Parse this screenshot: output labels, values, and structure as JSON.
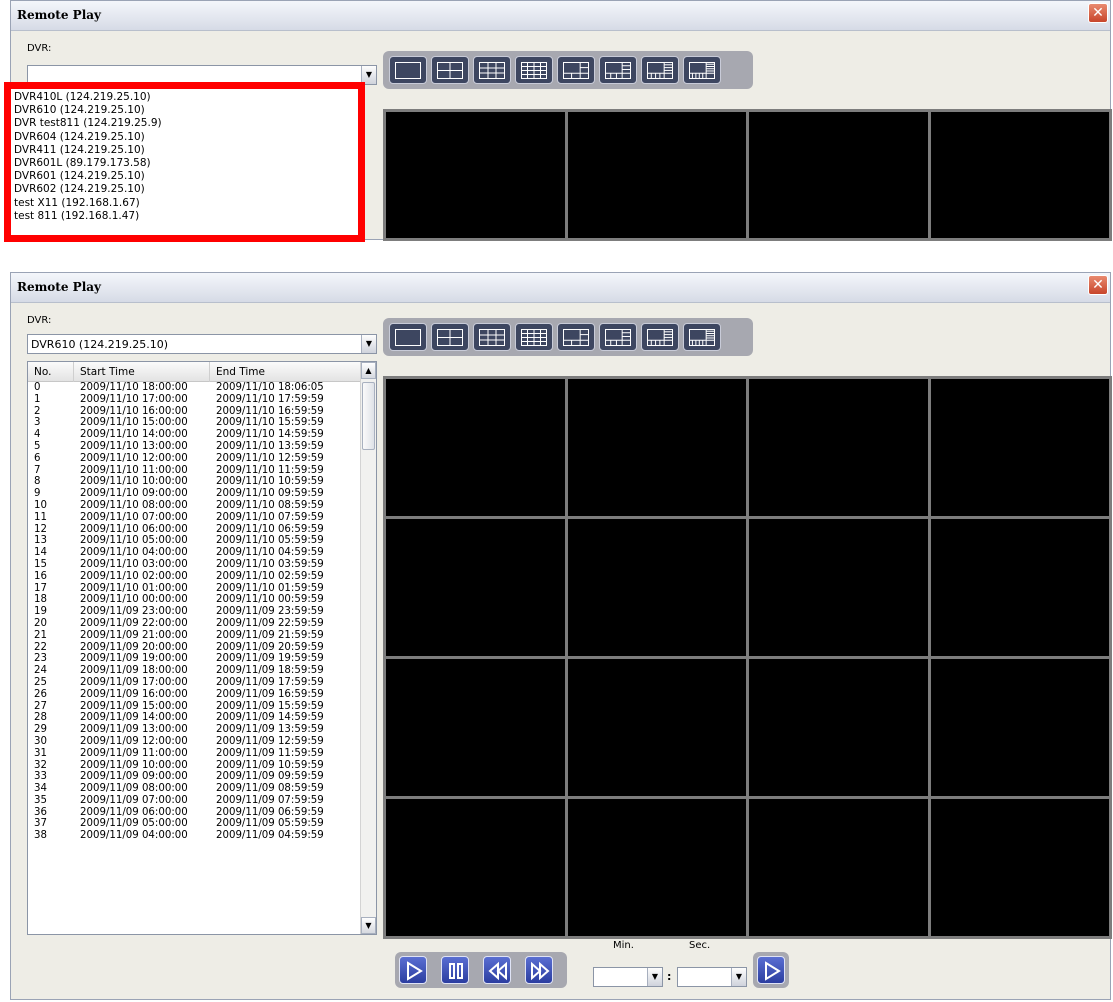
{
  "window1": {
    "title": "Remote Play",
    "close_glyph": "✕",
    "dvr_label": "DVR:",
    "dvr_value": "",
    "dvr_list": [
      "DVR410L (124.219.25.10)",
      "DVR610 (124.219.25.10)",
      "DVR test811 (124.219.25.9)",
      "DVR604 (124.219.25.10)",
      "DVR411 (124.219.25.10)",
      "DVR601L (89.179.173.58)",
      "DVR601 (124.219.25.10)",
      "DVR602 (124.219.25.10)",
      "test X11 (192.168.1.67)",
      "test 811 (192.168.1.47)"
    ]
  },
  "window2": {
    "title": "Remote Play",
    "close_glyph": "✕",
    "dvr_label": "DVR:",
    "dvr_value": "DVR610 (124.219.25.10)",
    "columns": [
      "No.",
      "Start Time",
      "End Time"
    ],
    "rows": [
      [
        "0",
        "2009/11/10 18:00:00",
        "2009/11/10 18:06:05"
      ],
      [
        "1",
        "2009/11/10 17:00:00",
        "2009/11/10 17:59:59"
      ],
      [
        "2",
        "2009/11/10 16:00:00",
        "2009/11/10 16:59:59"
      ],
      [
        "3",
        "2009/11/10 15:00:00",
        "2009/11/10 15:59:59"
      ],
      [
        "4",
        "2009/11/10 14:00:00",
        "2009/11/10 14:59:59"
      ],
      [
        "5",
        "2009/11/10 13:00:00",
        "2009/11/10 13:59:59"
      ],
      [
        "6",
        "2009/11/10 12:00:00",
        "2009/11/10 12:59:59"
      ],
      [
        "7",
        "2009/11/10 11:00:00",
        "2009/11/10 11:59:59"
      ],
      [
        "8",
        "2009/11/10 10:00:00",
        "2009/11/10 10:59:59"
      ],
      [
        "9",
        "2009/11/10 09:00:00",
        "2009/11/10 09:59:59"
      ],
      [
        "10",
        "2009/11/10 08:00:00",
        "2009/11/10 08:59:59"
      ],
      [
        "11",
        "2009/11/10 07:00:00",
        "2009/11/10 07:59:59"
      ],
      [
        "12",
        "2009/11/10 06:00:00",
        "2009/11/10 06:59:59"
      ],
      [
        "13",
        "2009/11/10 05:00:00",
        "2009/11/10 05:59:59"
      ],
      [
        "14",
        "2009/11/10 04:00:00",
        "2009/11/10 04:59:59"
      ],
      [
        "15",
        "2009/11/10 03:00:00",
        "2009/11/10 03:59:59"
      ],
      [
        "16",
        "2009/11/10 02:00:00",
        "2009/11/10 02:59:59"
      ],
      [
        "17",
        "2009/11/10 01:00:00",
        "2009/11/10 01:59:59"
      ],
      [
        "18",
        "2009/11/10 00:00:00",
        "2009/11/10 00:59:59"
      ],
      [
        "19",
        "2009/11/09 23:00:00",
        "2009/11/09 23:59:59"
      ],
      [
        "20",
        "2009/11/09 22:00:00",
        "2009/11/09 22:59:59"
      ],
      [
        "21",
        "2009/11/09 21:00:00",
        "2009/11/09 21:59:59"
      ],
      [
        "22",
        "2009/11/09 20:00:00",
        "2009/11/09 20:59:59"
      ],
      [
        "23",
        "2009/11/09 19:00:00",
        "2009/11/09 19:59:59"
      ],
      [
        "24",
        "2009/11/09 18:00:00",
        "2009/11/09 18:59:59"
      ],
      [
        "25",
        "2009/11/09 17:00:00",
        "2009/11/09 17:59:59"
      ],
      [
        "26",
        "2009/11/09 16:00:00",
        "2009/11/09 16:59:59"
      ],
      [
        "27",
        "2009/11/09 15:00:00",
        "2009/11/09 15:59:59"
      ],
      [
        "28",
        "2009/11/09 14:00:00",
        "2009/11/09 14:59:59"
      ],
      [
        "29",
        "2009/11/09 13:00:00",
        "2009/11/09 13:59:59"
      ],
      [
        "30",
        "2009/11/09 12:00:00",
        "2009/11/09 12:59:59"
      ],
      [
        "31",
        "2009/11/09 11:00:00",
        "2009/11/09 11:59:59"
      ],
      [
        "32",
        "2009/11/09 10:00:00",
        "2009/11/09 10:59:59"
      ],
      [
        "33",
        "2009/11/09 09:00:00",
        "2009/11/09 09:59:59"
      ],
      [
        "34",
        "2009/11/09 08:00:00",
        "2009/11/09 08:59:59"
      ],
      [
        "35",
        "2009/11/09 07:00:00",
        "2009/11/09 07:59:59"
      ],
      [
        "36",
        "2009/11/09 06:00:00",
        "2009/11/09 06:59:59"
      ],
      [
        "37",
        "2009/11/09 05:00:00",
        "2009/11/09 05:59:59"
      ],
      [
        "38",
        "2009/11/09 04:00:00",
        "2009/11/09 04:59:59"
      ]
    ],
    "min_label": "Min.",
    "sec_label": "Sec.",
    "time_separator": ":",
    "min_value": "",
    "sec_value": ""
  },
  "layout_buttons": [
    "layout-1x1-icon",
    "layout-2x2-icon",
    "layout-3x3-icon",
    "layout-4x4-icon",
    "layout-1plus5-icon",
    "layout-1plus7-icon",
    "layout-1plus9-icon",
    "layout-1plus12-icon"
  ],
  "playback_buttons": [
    "play-icon",
    "pause-icon",
    "rewind-icon",
    "fast-forward-icon"
  ],
  "colors": {
    "highlight_box": "#ff0000",
    "video_background": "#000000",
    "button_blue": "#2b3da0"
  }
}
